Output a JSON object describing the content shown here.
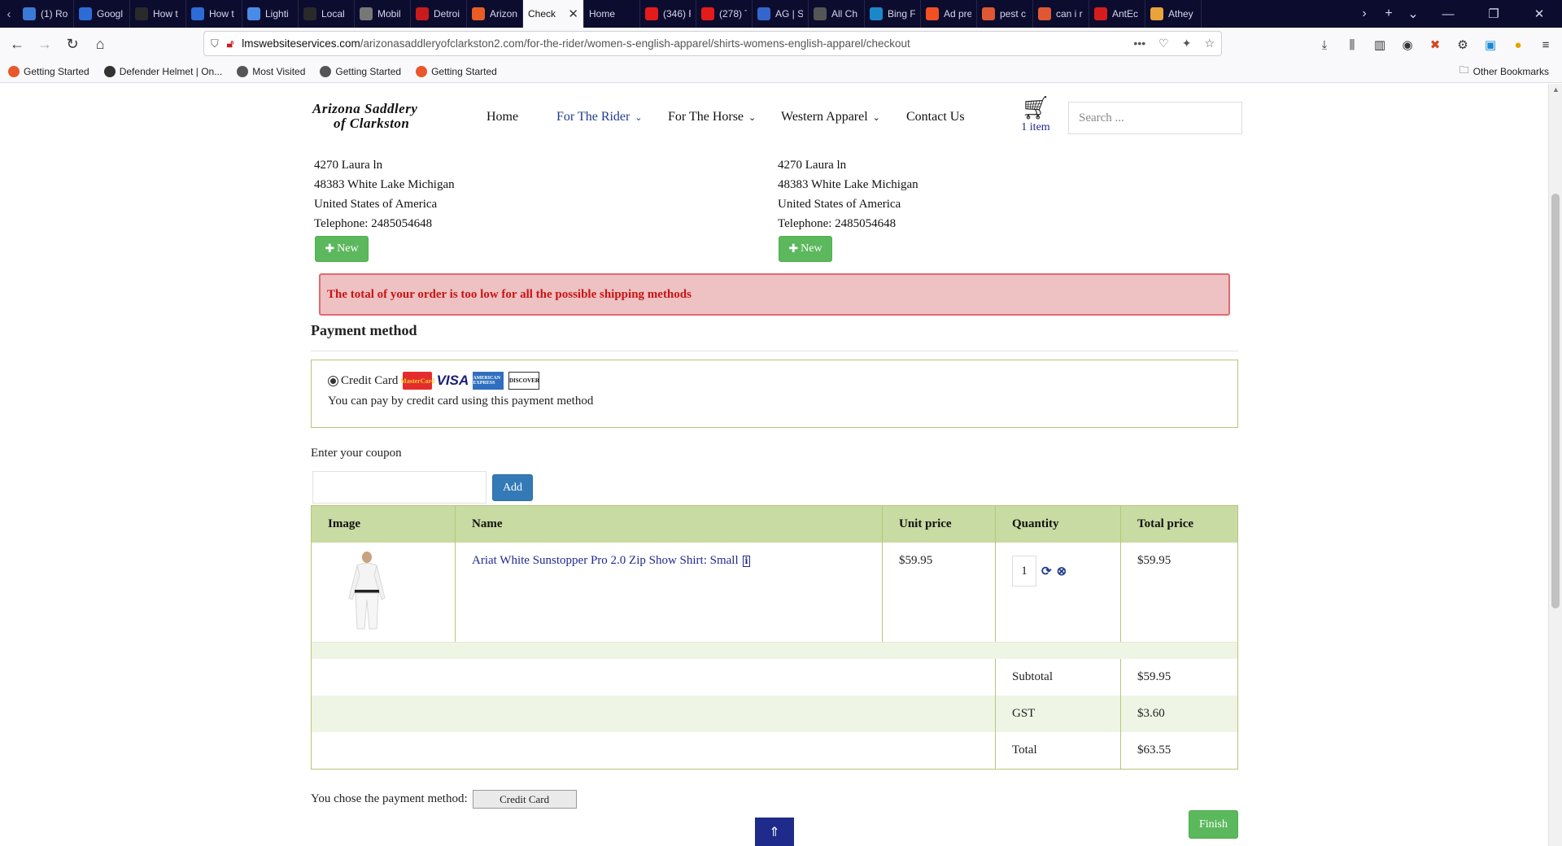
{
  "browser": {
    "tabs": [
      {
        "label": "(1) Ro",
        "icon": "globe-icon",
        "color": "#3b79d6"
      },
      {
        "label": "Googl",
        "icon": "tm-icon",
        "color": "#2d6bd6"
      },
      {
        "label": "How t",
        "icon": "book-icon",
        "color": "#2a2a2a"
      },
      {
        "label": "How t",
        "icon": "m-icon",
        "color": "#2d6bd6"
      },
      {
        "label": "Lighti",
        "icon": "link-icon",
        "color": "#4a8be8"
      },
      {
        "label": "Local",
        "icon": "book-icon",
        "color": "#2a2a2a"
      },
      {
        "label": "Mobil",
        "icon": "w-icon",
        "color": "#777777"
      },
      {
        "label": "Detroi",
        "icon": "car-icon",
        "color": "#c81b1b"
      },
      {
        "label": "Arizon",
        "icon": "joomla-icon",
        "color": "#e85d24"
      },
      {
        "label": "Check",
        "icon": "none",
        "color": "#ffffff",
        "active": true
      },
      {
        "label": "Home",
        "icon": "none",
        "color": "#0c0c2e"
      },
      {
        "label": "(346) F",
        "icon": "youtube-icon",
        "color": "#e41b1b"
      },
      {
        "label": "(278) T",
        "icon": "youtube-icon",
        "color": "#e41b1b"
      },
      {
        "label": "AG | Sl",
        "icon": "ag-icon",
        "color": "#3366cc"
      },
      {
        "label": "All Ch",
        "icon": "x-icon",
        "color": "#555555"
      },
      {
        "label": "Bing F",
        "icon": "bing-icon",
        "color": "#1a88c9"
      },
      {
        "label": "Ad pre",
        "icon": "microsoft-icon",
        "color": "#f25022"
      },
      {
        "label": "pest c",
        "icon": "ddg-icon",
        "color": "#de5833"
      },
      {
        "label": "can i r",
        "icon": "ddg-icon",
        "color": "#de5833"
      },
      {
        "label": "AntEc",
        "icon": "ant-icon",
        "color": "#d61d1d"
      },
      {
        "label": "Athey",
        "icon": "a-icon",
        "color": "#e8a33a"
      }
    ],
    "url_host": "lmswebsiteservices.com",
    "url_path": "/arizonasaddleryofclarkston2.com/for-the-rider/women-s-english-apparel/shirts-womens-english-apparel/checkout",
    "bookmarks": [
      {
        "label": "Getting Started",
        "color": "#e8582c"
      },
      {
        "label": "Defender Helmet | On...",
        "color": "#333333"
      },
      {
        "label": "Most Visited",
        "color": "#555555"
      },
      {
        "label": "Getting Started",
        "color": "#555555"
      },
      {
        "label": "Getting Started",
        "color": "#e8582c"
      }
    ],
    "other_bookmarks": "Other Bookmarks"
  },
  "site": {
    "logo_line1": "Arizona Saddlery",
    "logo_line2": "of Clarkston",
    "menu": {
      "home": "Home",
      "rider": "For The Rider",
      "horse": "For The Horse",
      "western": "Western Apparel",
      "contact": "Contact Us"
    },
    "cart_count": "1 item",
    "search_placeholder": "Search ..."
  },
  "addresses": {
    "billing": {
      "street": "4270 Laura ln",
      "city": "48383 White Lake Michigan",
      "country": "United States of America",
      "phone": "Telephone: 2485054648",
      "new_label": "New"
    },
    "shipping": {
      "street": "4270 Laura ln",
      "city": "48383 White Lake Michigan",
      "country": "United States of America",
      "phone": "Telephone: 2485054648",
      "new_label": "New"
    }
  },
  "alert_text": "The total of your order is too low for all the possible shipping methods",
  "payment": {
    "title": "Payment method",
    "option_label": "Credit Card",
    "cards": {
      "mastercard": "MasterCard",
      "visa": "VISA",
      "amex": "AMERICAN EXPRESS",
      "discover": "DISCOVER"
    },
    "description": "You can pay by credit card using this payment method"
  },
  "coupon": {
    "label": "Enter your coupon",
    "value": "",
    "add_label": "Add"
  },
  "cart": {
    "headers": [
      "Image",
      "Name",
      "Unit price",
      "Quantity",
      "Total price"
    ],
    "item": {
      "name": "Ariat White Sunstopper Pro 2.0 Zip Show Shirt: Small",
      "unit_price": "$59.95",
      "quantity": "1",
      "total": "$59.95"
    },
    "summary": [
      {
        "label": "Subtotal",
        "value": "$59.95"
      },
      {
        "label": "GST",
        "value": "$3.60"
      },
      {
        "label": "Total",
        "value": "$63.55"
      }
    ]
  },
  "footer": {
    "chosen_text": "You chose the payment method:",
    "chosen_button": "Credit Card",
    "finish_label": "Finish"
  }
}
